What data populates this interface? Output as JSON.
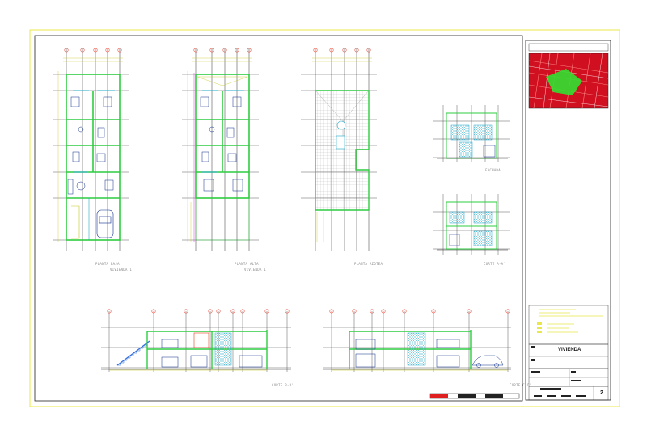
{
  "drawing": {
    "colors": {
      "frame": "#e8e84a",
      "border": "#222222",
      "wall": "#2ecc40",
      "structure": "#27ae60",
      "axis": "#333333",
      "axis_bubble": "#e74c3c",
      "furniture": "#0a2a8a",
      "glass": "#22a8c8",
      "dimension": "#c8c820",
      "hatch": "#9a9a9a",
      "site_plan_bg": "#d01020",
      "site_plan_streets": "#ff3030",
      "site_plan_green": "#30e030",
      "stair": "#3070e0"
    },
    "views": {
      "plan_ground": {
        "title": "PLANTA BAJA",
        "subtitle": "VIVIENDA 1"
      },
      "plan_upper": {
        "title": "PLANTA ALTA",
        "subtitle": "VIVIENDA 1"
      },
      "plan_roof": {
        "title": "PLANTA AZOTEA"
      },
      "facade": {
        "title": "FACHADA"
      },
      "section_aa": {
        "title": "CORTE A-A'"
      },
      "section_bb": {
        "title": "CORTE B-B'"
      },
      "section_cc": {
        "title": "CORTE C-C'"
      }
    },
    "title_block": {
      "project": "VIVIENDA",
      "sheet_number": "2"
    }
  }
}
